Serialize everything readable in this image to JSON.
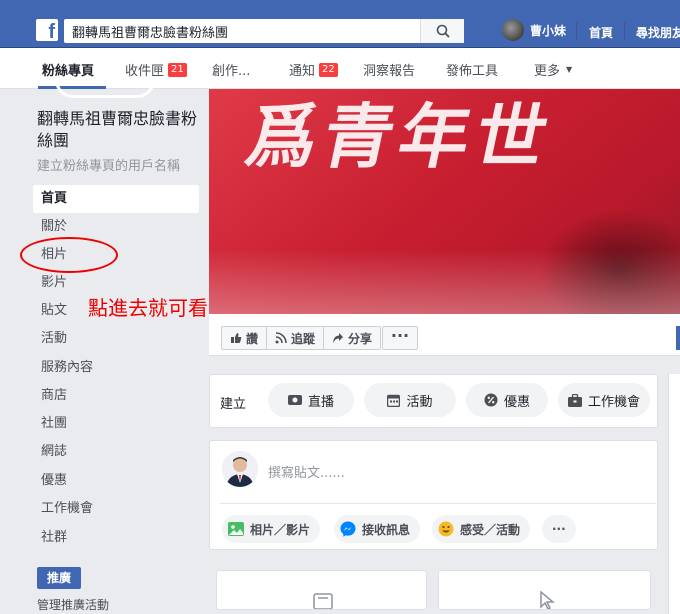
{
  "topbar": {
    "search_value": "翻轉馬祖曹爾忠臉書粉絲團",
    "user_name": "曹小妹",
    "home": "首頁",
    "find_friends": "尋找朋友"
  },
  "tabs": [
    {
      "label": "粉絲專頁"
    },
    {
      "label": "收件匣",
      "badge": "21"
    },
    {
      "label": "創作..."
    },
    {
      "label": "通知",
      "badge": "22"
    },
    {
      "label": "洞察報告"
    },
    {
      "label": "發佈工具"
    },
    {
      "label": "更多"
    }
  ],
  "sidebar": {
    "page_name": "翻轉馬祖曹爾忠臉書粉絲團",
    "username_prompt": "建立粉絲專頁的用戶名稱",
    "nav": [
      "首頁",
      "關於",
      "相片",
      "影片",
      "貼文",
      "活動",
      "服務內容",
      "商店",
      "社團",
      "網誌",
      "優惠",
      "工作機會",
      "社群"
    ],
    "promote": "推廣",
    "manage": "管理推廣活動"
  },
  "annotation": {
    "text": "點進去就可看到照片",
    "color": "#ee0000"
  },
  "cover": {
    "text": "爲青年世"
  },
  "actions": {
    "like": "讚",
    "follow": "追蹤",
    "share": "分享",
    "more": "···"
  },
  "create": {
    "label": "建立",
    "live": "直播",
    "event": "活動",
    "offer": "優惠",
    "job": "工作機會"
  },
  "composer": {
    "placeholder": "撰寫貼文......",
    "photo": "相片／影片",
    "messages": "接收訊息",
    "feeling": "感受／活動",
    "more": "···"
  },
  "colors": {
    "brand_blue": "#4267b2",
    "badge_red": "#fa3e3e",
    "cover_red": "#c81f31"
  }
}
